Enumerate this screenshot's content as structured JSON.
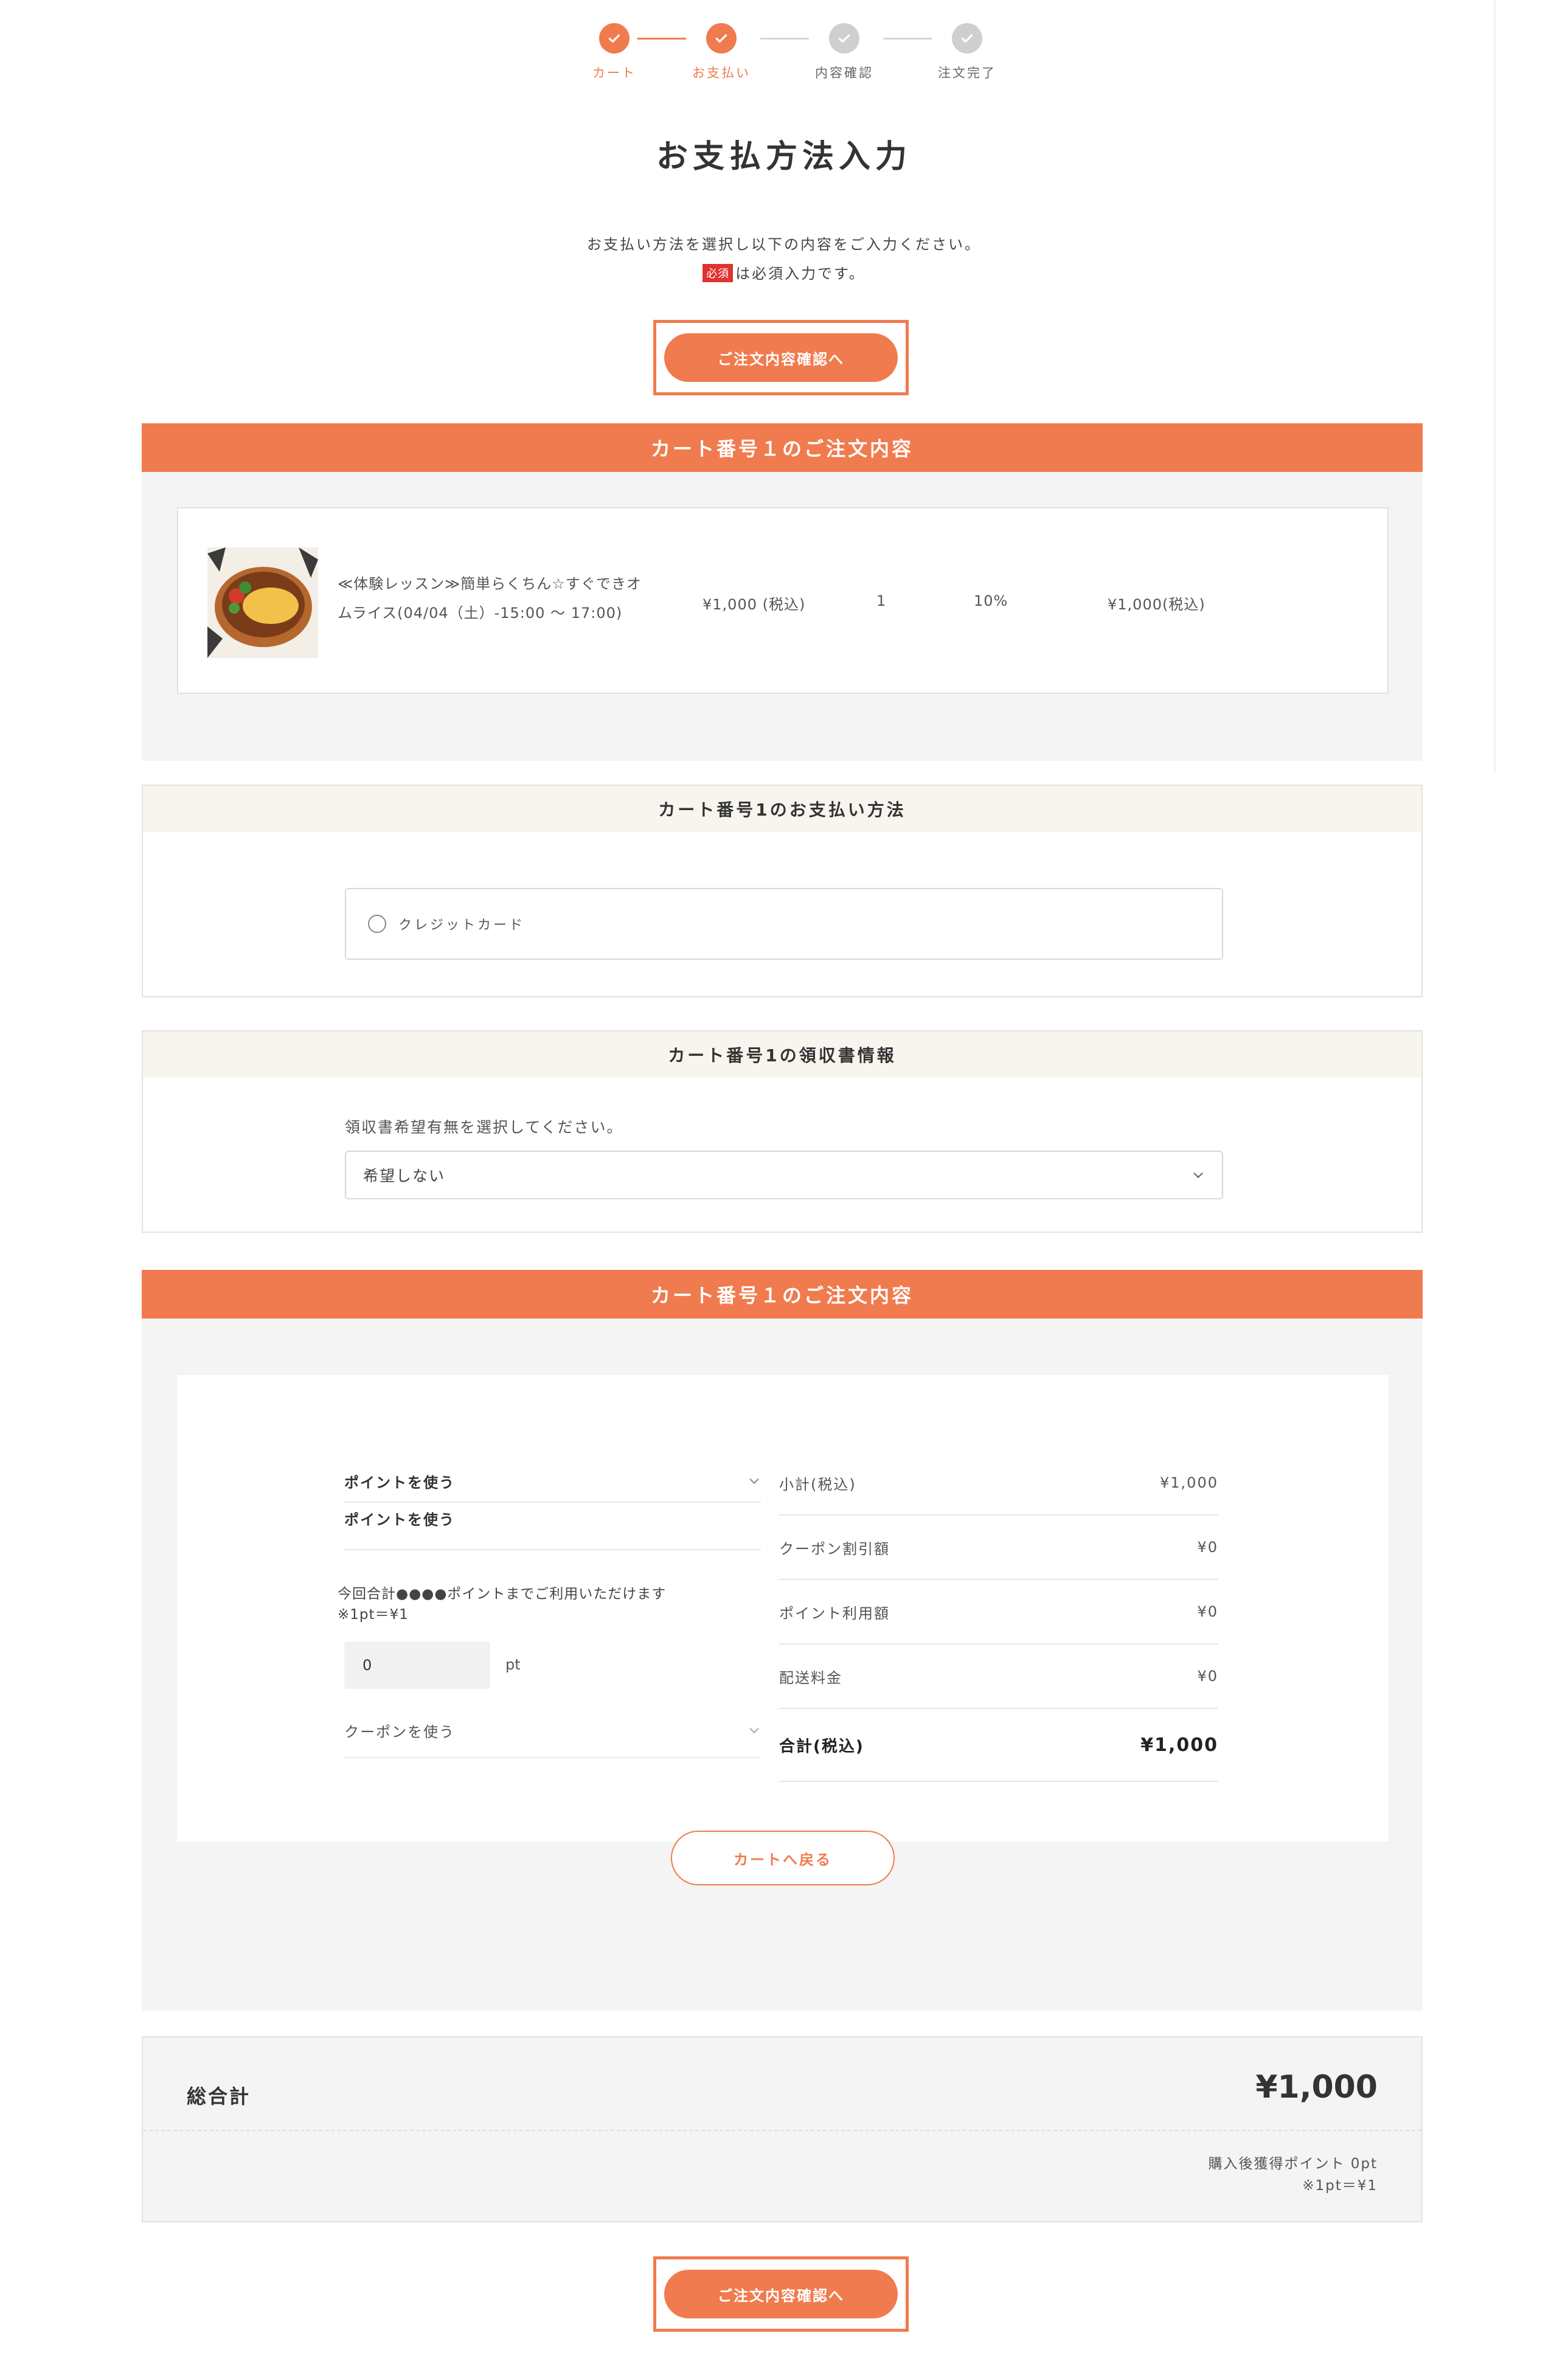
{
  "stepper": {
    "steps": [
      {
        "label": "カート",
        "state": "done"
      },
      {
        "label": "お支払い",
        "state": "current"
      },
      {
        "label": "内容確認",
        "state": "todo"
      },
      {
        "label": "注文完了",
        "state": "todo"
      }
    ]
  },
  "page": {
    "title": "お支払方法入力",
    "intro": "お支払い方法を選択し以下の内容をご入力ください。",
    "required_badge": "必須",
    "required_note": "は必須入力です。",
    "confirm_button": "ご注文内容確認へ"
  },
  "cart_items": {
    "heading": "カート番号１のご注文内容",
    "item": {
      "name_line1": "≪体験レッスン≫簡単らくちん☆すぐできオ",
      "name_line2": "ムライス(04/04（土）-15:00 〜 17:00)",
      "unit_price": "¥1,000 (税込)",
      "quantity": "1",
      "tax_rate": "10%",
      "subtotal": "¥1,000(税込)"
    }
  },
  "payment": {
    "heading": "カート番号1のお支払い方法",
    "option": "クレジットカード"
  },
  "receipt": {
    "heading": "カート番号1の領収書情報",
    "label": "領収書希望有無を選択してください。",
    "selected": "希望しない"
  },
  "summary": {
    "heading": "カート番号１のご注文内容",
    "points_toggle": "ポイントを使う",
    "points_title": "ポイントを使う",
    "points_note1": "今回合計●●●●ポイントまでご利用いただけます",
    "points_note2": "※1pt＝¥1",
    "points_value": "0",
    "points_unit": "pt",
    "coupon_toggle": "クーポンを使う",
    "rows": [
      {
        "label": "小計(税込)",
        "value": "¥1,000"
      },
      {
        "label": "クーポン割引額",
        "value": "¥0"
      },
      {
        "label": "ポイント利用額",
        "value": "¥0"
      },
      {
        "label": "配送料金",
        "value": "¥0"
      }
    ],
    "total_label": "合計(税込)",
    "total_value": "¥1,000",
    "back_button": "カートへ戻る"
  },
  "grand_total": {
    "label": "総合計",
    "value": "¥1,000",
    "points_earned": "購入後獲得ポイント 0pt",
    "points_rate": "※1pt＝¥1"
  },
  "colors": {
    "accent": "#f07b4e",
    "required": "#e0322f",
    "panel_head": "#f8f5ef",
    "block_bg": "#f4f4f4"
  }
}
